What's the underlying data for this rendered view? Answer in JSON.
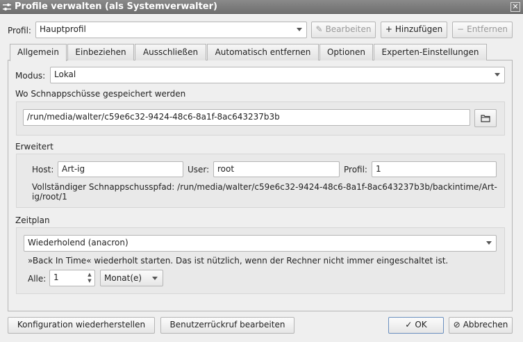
{
  "window": {
    "title": "Profile verwalten (als Systemverwalter)",
    "title_icon": "sliders-icon",
    "close_glyph": "✕"
  },
  "profile_bar": {
    "label": "Profil:",
    "selected": "Hauptprofil",
    "edit_label": "Bearbeiten",
    "add_label": "Hinzufügen",
    "remove_label": "Entfernen"
  },
  "tabs": [
    {
      "label": "Allgemein",
      "active": true
    },
    {
      "label": "Einbeziehen",
      "active": false
    },
    {
      "label": "Ausschließen",
      "active": false
    },
    {
      "label": "Automatisch entfernen",
      "active": false
    },
    {
      "label": "Optionen",
      "active": false
    },
    {
      "label": "Experten-Einstellungen",
      "active": false
    }
  ],
  "general": {
    "mode_label": "Modus:",
    "mode_value": "Lokal",
    "where_heading": "Wo Schnappschüsse gespeichert werden",
    "path_value": "/run/media/walter/c59e6c32-9424-48c6-8a1f-8ac643237b3b",
    "advanced_heading": "Erweitert",
    "host_label": "Host:",
    "host_value": "Art-ig",
    "user_label": "User:",
    "user_value": "root",
    "profile_label": "Profil:",
    "profile_value": "1",
    "full_path_line1": "Vollständiger Schnappschusspfad: /run/media/walter/c59e6c32-9424-48c6-8a1f-8ac643237b3b/backintime/Art-",
    "full_path_line2": "ig/root/1",
    "schedule_heading": "Zeitplan",
    "schedule_value": "Wiederholend (anacron)",
    "schedule_hint": "»Back In Time« wiederholt starten. Das ist nützlich, wenn der Rechner nicht immer eingeschaltet ist.",
    "every_label": "Alle:",
    "every_value": "1",
    "unit_value": "Monat(e)"
  },
  "footer": {
    "restore_label": "Konfiguration wiederherstellen",
    "callback_label": "Benutzerrückruf bearbeiten",
    "ok_label": "OK",
    "cancel_label": "Abbrechen"
  }
}
